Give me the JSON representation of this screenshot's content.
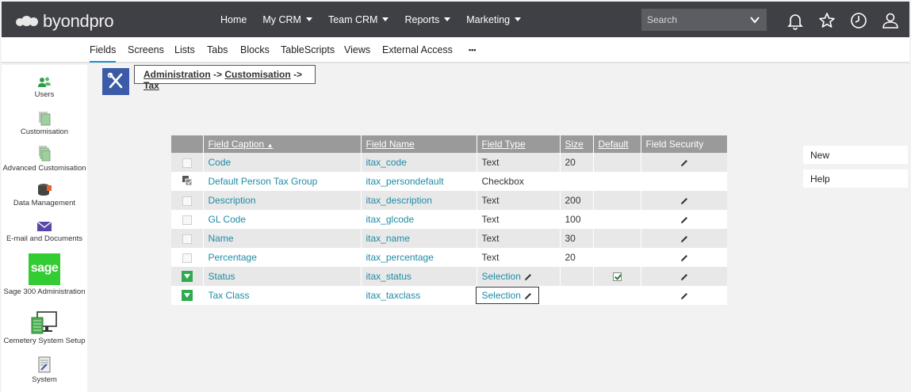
{
  "brand": {
    "name": "byondpro"
  },
  "topnav": {
    "items": [
      {
        "label": "Home",
        "dropdown": false
      },
      {
        "label": "My CRM",
        "dropdown": true
      },
      {
        "label": "Team CRM",
        "dropdown": true
      },
      {
        "label": "Reports",
        "dropdown": true
      },
      {
        "label": "Marketing",
        "dropdown": true
      }
    ],
    "search_placeholder": "Search",
    "icons": [
      "bell-icon",
      "star-icon",
      "clock-icon",
      "user-icon"
    ]
  },
  "subnav": {
    "tabs": [
      "Fields",
      "Screens",
      "Lists",
      "Tabs",
      "Blocks",
      "TableScripts",
      "Views",
      "External Access",
      "•••"
    ],
    "active": "Fields"
  },
  "sidebar": {
    "items": [
      {
        "label": "Users",
        "icon": "users-icon"
      },
      {
        "label": "Customisation",
        "icon": "customisation-icon"
      },
      {
        "label": "Advanced Customisation",
        "icon": "advanced-customisation-icon"
      },
      {
        "label": "Data Management",
        "icon": "database-icon"
      },
      {
        "label": "E-mail and Documents",
        "icon": "envelope-icon"
      },
      {
        "label": "Sage 300 Administration",
        "icon": "sage-logo-icon",
        "logo_text": "sage"
      },
      {
        "label": "Cemetery System Setup",
        "icon": "monitor-icon"
      },
      {
        "label": "System",
        "icon": "system-icon"
      }
    ]
  },
  "breadcrumb": {
    "parts": [
      "Administration",
      "Customisation",
      "Tax"
    ],
    "separator": "->"
  },
  "table": {
    "headers": [
      "Field Caption",
      "Field Name",
      "Field Type",
      "Size",
      "Default",
      "Field Security"
    ],
    "sorted_column": "Field Caption",
    "rows": [
      {
        "icon": "empty",
        "caption": "Code",
        "name": "itax_code",
        "type": "Text",
        "size": "20",
        "default": false,
        "type_editable": false
      },
      {
        "icon": "checkbox",
        "caption": "Default Person Tax Group",
        "name": "itax_persondefault",
        "type": "Checkbox",
        "size": "",
        "default": false,
        "type_editable": false
      },
      {
        "icon": "empty",
        "caption": "Description",
        "name": "itax_description",
        "type": "Text",
        "size": "200",
        "default": false,
        "type_editable": false
      },
      {
        "icon": "empty",
        "caption": "GL Code",
        "name": "itax_glcode",
        "type": "Text",
        "size": "100",
        "default": false,
        "type_editable": false
      },
      {
        "icon": "empty",
        "caption": "Name",
        "name": "itax_name",
        "type": "Text",
        "size": "30",
        "default": false,
        "type_editable": false
      },
      {
        "icon": "empty",
        "caption": "Percentage",
        "name": "itax_percentage",
        "type": "Text",
        "size": "20",
        "default": false,
        "type_editable": false
      },
      {
        "icon": "selection",
        "caption": "Status",
        "name": "itax_status",
        "type": "Selection",
        "size": "",
        "default": true,
        "type_editable": true
      },
      {
        "icon": "selection",
        "caption": "Tax Class",
        "name": "itax_taxclass",
        "type": "Selection",
        "size": "",
        "default": false,
        "type_editable": true,
        "focused": true
      }
    ]
  },
  "actions": {
    "new_label": "New",
    "help_label": "Help"
  },
  "colors": {
    "topbar": "#3f3f46",
    "link": "#1e8ca5",
    "header": "#9a9a9a",
    "accent": "#1e8fd2",
    "sage": "#33cc33"
  }
}
